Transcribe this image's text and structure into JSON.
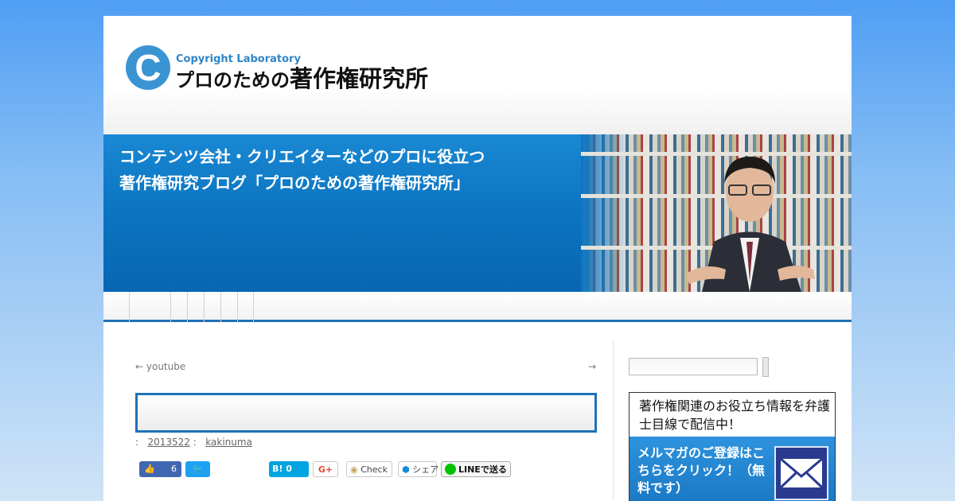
{
  "header": {
    "logo_letter": "C",
    "logo_subtitle": "Copyright Laboratory",
    "logo_prefix": "プロのための",
    "logo_main": "著作権研究所"
  },
  "banner": {
    "line1": "コンテンツ会社・クリエイターなどのプロに役立つ",
    "line2": "著作権研究ブログ「プロのための著作権研究所」"
  },
  "post_nav": {
    "prev": "← youtube",
    "next": "→"
  },
  "meta": {
    "sep1": ":",
    "date": "2013522",
    "sep2": ":",
    "author": "kakinuma"
  },
  "share": {
    "fb_count": "6",
    "hatena": "B! 0",
    "gplus": "G+",
    "mixi": "Check",
    "share": "シェア",
    "line": "LINEで送る"
  },
  "sidebar": {
    "mag_text": "著作権関連のお役立ち情報を弁護士目線で配信中！",
    "mag_cta": "メルマガのご登録はこちらをクリック！（無料です）"
  },
  "colors": {
    "accent": "#1f72b8",
    "banner_blue": "#0b74c0",
    "logo_blue": "#3a93d3"
  }
}
